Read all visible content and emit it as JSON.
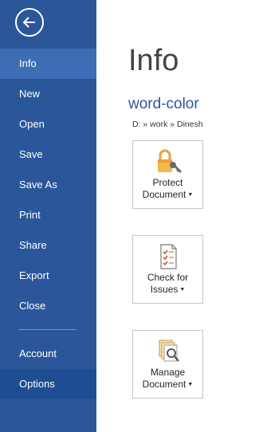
{
  "nav": {
    "back_icon": "back-arrow-icon",
    "items": [
      {
        "label": "Info"
      },
      {
        "label": "New"
      },
      {
        "label": "Open"
      },
      {
        "label": "Save"
      },
      {
        "label": "Save As"
      },
      {
        "label": "Print"
      },
      {
        "label": "Share"
      },
      {
        "label": "Export"
      },
      {
        "label": "Close"
      },
      {
        "label": "Account"
      },
      {
        "label": "Options"
      }
    ]
  },
  "main": {
    "title": "Info",
    "doc_name": "word-color",
    "doc_path": "D: » work » Dinesh",
    "tiles": [
      {
        "line1": "Protect",
        "line2": "Document",
        "icon": "lock-key-icon"
      },
      {
        "line1": "Check for",
        "line2": "Issues",
        "icon": "checklist-icon"
      },
      {
        "line1": "Manage",
        "line2": "Document",
        "icon": "manage-document-icon"
      }
    ]
  },
  "colors": {
    "nav_bg": "#2b579a",
    "nav_active": "#3e6db5",
    "accent": "#2b579a"
  }
}
